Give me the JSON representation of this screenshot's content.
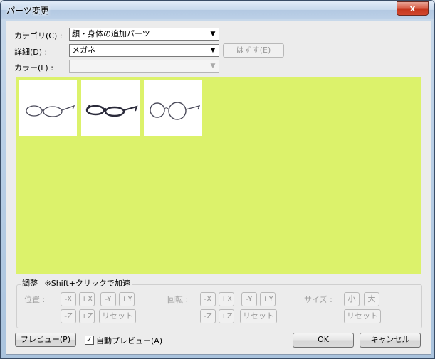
{
  "window": {
    "title": "パーツ変更",
    "close_label": "x"
  },
  "category": {
    "label": "カテゴリ(C) :",
    "value": "顔・身体の追加パーツ"
  },
  "detail": {
    "label": "詳細(D) :",
    "value": "メガネ",
    "remove_label": "はずす(E)"
  },
  "color": {
    "label": "カラー(L) :",
    "value": ""
  },
  "thumbnails": [
    {
      "name": "glasses-oval"
    },
    {
      "name": "glasses-dark-frame"
    },
    {
      "name": "glasses-round"
    }
  ],
  "adjust": {
    "title": "調整",
    "hint": "※Shift+クリックで加速",
    "position": {
      "label": "位置 :",
      "buttons": [
        "-X",
        "+X",
        "-Y",
        "+Y",
        "-Z",
        "+Z",
        "リセット"
      ]
    },
    "rotation": {
      "label": "回転 :",
      "buttons": [
        "-X",
        "+X",
        "-Y",
        "+Y",
        "-Z",
        "+Z",
        "リセット"
      ]
    },
    "size": {
      "label": "サイズ :",
      "buttons": [
        "小",
        "大",
        "リセット"
      ]
    }
  },
  "footer": {
    "preview_label": "プレビュー(P)",
    "auto_preview_label": "自動プレビュー(A)",
    "auto_preview_checked": true,
    "ok_label": "OK",
    "cancel_label": "キャンセル"
  },
  "colors": {
    "preview_bg": "#dcf26b",
    "close_red": "#c3341b"
  }
}
